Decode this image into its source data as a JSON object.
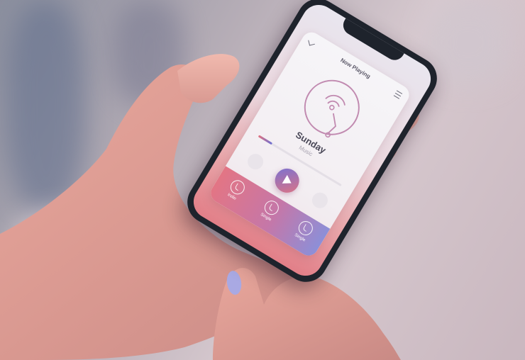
{
  "player": {
    "title": "Now Playing",
    "song": "Sunday",
    "genre": "Music",
    "progress": 0.16
  },
  "modes": [
    {
      "label": "Indie",
      "icon": "genre-icon"
    },
    {
      "label": "Single",
      "icon": "genre-icon"
    },
    {
      "label": "Single",
      "icon": "genre-icon"
    }
  ],
  "colors": {
    "accent_pink": "#e37584",
    "accent_purple": "#7771d4",
    "phone_body": "#1e232c",
    "nail_polish": "#a9a9e3"
  }
}
